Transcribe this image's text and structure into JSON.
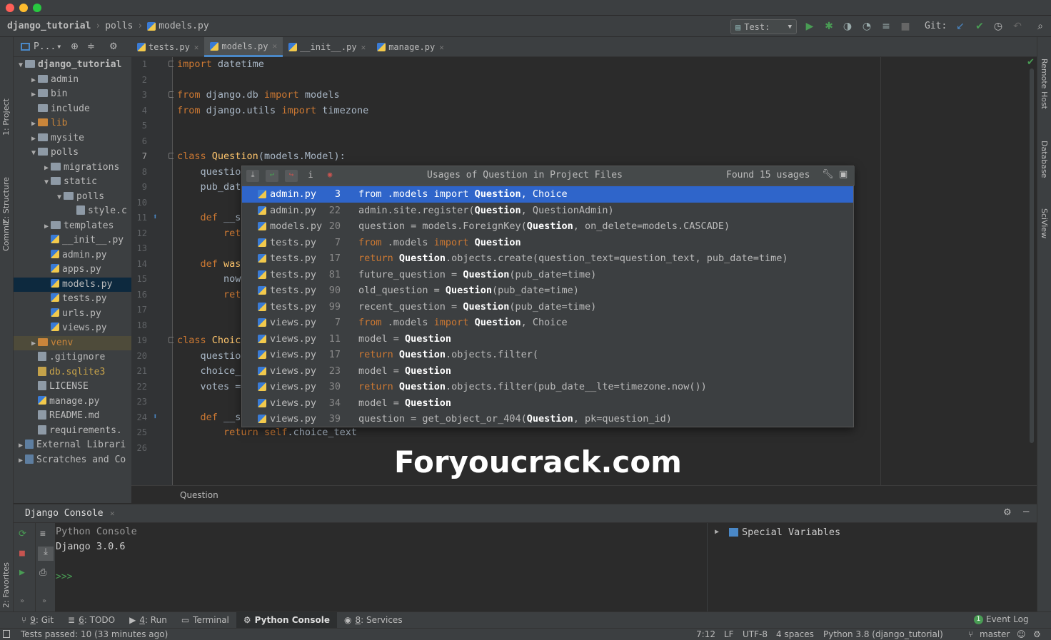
{
  "breadcrumb": {
    "project": "django_tutorial",
    "folder": "polls",
    "file": "models.py"
  },
  "toolbar": {
    "run_config": "Test:",
    "git_label": "Git:"
  },
  "project_panel": {
    "title": "P..."
  },
  "editor_tabs": [
    {
      "label": "tests.py"
    },
    {
      "label": "models.py"
    },
    {
      "label": "__init__.py"
    },
    {
      "label": "manage.py"
    }
  ],
  "left_tools": {
    "project": "1: Project",
    "structure": "Z: Structure",
    "commit": "Commit",
    "favorites": "2: Favorites"
  },
  "right_tools": {
    "remote": "Remote Host",
    "database": "Database",
    "sciview": "SciView"
  },
  "tree": [
    {
      "label": "django_tutorial",
      "type": "folder",
      "depth": 0,
      "arrow": "▼",
      "bold": true
    },
    {
      "label": "admin",
      "type": "folder",
      "depth": 1,
      "arrow": "▶"
    },
    {
      "label": "bin",
      "type": "folder",
      "depth": 1,
      "arrow": "▶"
    },
    {
      "label": "include",
      "type": "folder",
      "depth": 1,
      "arrow": ""
    },
    {
      "label": "lib",
      "type": "folder",
      "depth": 1,
      "arrow": "▶",
      "color": "#c9853a"
    },
    {
      "label": "mysite",
      "type": "folder",
      "depth": 1,
      "arrow": "▶"
    },
    {
      "label": "polls",
      "type": "folder",
      "depth": 1,
      "arrow": "▼"
    },
    {
      "label": "migrations",
      "type": "folder",
      "depth": 2,
      "arrow": "▶"
    },
    {
      "label": "static",
      "type": "folder",
      "depth": 2,
      "arrow": "▼"
    },
    {
      "label": "polls",
      "type": "folder",
      "depth": 3,
      "arrow": "▼"
    },
    {
      "label": "style.c",
      "type": "file",
      "depth": 4,
      "arrow": ""
    },
    {
      "label": "templates",
      "type": "folder",
      "depth": 2,
      "arrow": "▶"
    },
    {
      "label": "__init__.py",
      "type": "py",
      "depth": 2,
      "arrow": ""
    },
    {
      "label": "admin.py",
      "type": "py",
      "depth": 2,
      "arrow": ""
    },
    {
      "label": "apps.py",
      "type": "py",
      "depth": 2,
      "arrow": ""
    },
    {
      "label": "models.py",
      "type": "py",
      "depth": 2,
      "arrow": "",
      "selected": true
    },
    {
      "label": "tests.py",
      "type": "py",
      "depth": 2,
      "arrow": ""
    },
    {
      "label": "urls.py",
      "type": "py",
      "depth": 2,
      "arrow": ""
    },
    {
      "label": "views.py",
      "type": "py",
      "depth": 2,
      "arrow": ""
    },
    {
      "label": "venv",
      "type": "folder",
      "depth": 1,
      "arrow": "▶",
      "color": "#c9853a",
      "venv": true
    },
    {
      "label": ".gitignore",
      "type": "file",
      "depth": 1,
      "arrow": ""
    },
    {
      "label": "db.sqlite3",
      "type": "db",
      "depth": 1,
      "arrow": "",
      "color": "#c9a44a"
    },
    {
      "label": "LICENSE",
      "type": "file",
      "depth": 1,
      "arrow": ""
    },
    {
      "label": "manage.py",
      "type": "py",
      "depth": 1,
      "arrow": ""
    },
    {
      "label": "README.md",
      "type": "file",
      "depth": 1,
      "arrow": ""
    },
    {
      "label": "requirements.",
      "type": "file",
      "depth": 1,
      "arrow": ""
    },
    {
      "label": "External Librari",
      "type": "lib",
      "depth": 0,
      "arrow": "▶"
    },
    {
      "label": "Scratches and Co",
      "type": "lib",
      "depth": 0,
      "arrow": "▶"
    }
  ],
  "line_numbers": [
    "1",
    "2",
    "3",
    "4",
    "5",
    "6",
    "7",
    "8",
    "9",
    "10",
    "11",
    "12",
    "13",
    "14",
    "15",
    "16",
    "17",
    "18",
    "19",
    "20",
    "21",
    "22",
    "23",
    "24",
    "25",
    "26"
  ],
  "code": [
    [
      {
        "t": "import",
        "c": "kw"
      },
      {
        "t": " datetime"
      }
    ],
    [],
    [
      {
        "t": "from",
        "c": "kw"
      },
      {
        "t": " django.db "
      },
      {
        "t": "import",
        "c": "kw"
      },
      {
        "t": " models"
      }
    ],
    [
      {
        "t": "from",
        "c": "kw"
      },
      {
        "t": " django.utils "
      },
      {
        "t": "import",
        "c": "kw"
      },
      {
        "t": " timezone"
      }
    ],
    [],
    [],
    [
      {
        "t": "class",
        "c": "kw"
      },
      {
        "t": " "
      },
      {
        "t": "Question",
        "c": "cls"
      },
      {
        "t": "(models.Model):"
      }
    ],
    [
      {
        "t": "    questio"
      }
    ],
    [
      {
        "t": "    pub_dat"
      }
    ],
    [],
    [
      {
        "t": "    "
      },
      {
        "t": "def",
        "c": "kw"
      },
      {
        "t": " __s"
      }
    ],
    [
      {
        "t": "        "
      },
      {
        "t": "ret",
        "c": "kw"
      }
    ],
    [],
    [
      {
        "t": "    "
      },
      {
        "t": "def",
        "c": "kw"
      },
      {
        "t": " "
      },
      {
        "t": "was",
        "c": "cls"
      }
    ],
    [
      {
        "t": "        now"
      }
    ],
    [
      {
        "t": "        "
      },
      {
        "t": "ret",
        "c": "kw"
      }
    ],
    [],
    [],
    [
      {
        "t": "class",
        "c": "kw"
      },
      {
        "t": " "
      },
      {
        "t": "Choic",
        "c": "cls"
      }
    ],
    [
      {
        "t": "    questio"
      }
    ],
    [
      {
        "t": "    choice_"
      }
    ],
    [
      {
        "t": "    votes ="
      }
    ],
    [],
    [
      {
        "t": "    "
      },
      {
        "t": "def",
        "c": "kw"
      },
      {
        "t": " __s"
      }
    ],
    [
      {
        "t": "        "
      },
      {
        "t": "return",
        "c": "kw"
      },
      {
        "t": " "
      },
      {
        "t": "self",
        "c": "kw"
      },
      {
        "t": ".choice_text"
      }
    ],
    []
  ],
  "editor_breadcrumb": "Question",
  "usages_popup": {
    "title": "Usages of Question in Project Files",
    "found": "Found 15 usages",
    "rows": [
      {
        "file": "admin.py",
        "line": "3",
        "code": [
          {
            "t": "from",
            "k": 1
          },
          {
            "t": " .models "
          },
          {
            "t": "import",
            "k": 1
          },
          {
            "t": " "
          },
          {
            "t": "Question",
            "b": 1
          },
          {
            "t": ", Choice"
          }
        ]
      },
      {
        "file": "admin.py",
        "line": "22",
        "code": [
          {
            "t": "admin.site.register("
          },
          {
            "t": "Question",
            "b": 1
          },
          {
            "t": ", QuestionAdmin)"
          }
        ]
      },
      {
        "file": "models.py",
        "line": "20",
        "code": [
          {
            "t": "question = models.ForeignKey("
          },
          {
            "t": "Question",
            "b": 1
          },
          {
            "t": ", on_delete=models.CASCADE)"
          }
        ]
      },
      {
        "file": "tests.py",
        "line": "7",
        "code": [
          {
            "t": "from",
            "k": 1
          },
          {
            "t": " .models "
          },
          {
            "t": "import",
            "k": 1
          },
          {
            "t": " "
          },
          {
            "t": "Question",
            "b": 1
          }
        ]
      },
      {
        "file": "tests.py",
        "line": "17",
        "code": [
          {
            "t": "return",
            "k": 1
          },
          {
            "t": " "
          },
          {
            "t": "Question",
            "b": 1
          },
          {
            "t": ".objects.create(question_text=question_text, pub_date=time)"
          }
        ]
      },
      {
        "file": "tests.py",
        "line": "81",
        "code": [
          {
            "t": "future_question = "
          },
          {
            "t": "Question",
            "b": 1
          },
          {
            "t": "(pub_date=time)"
          }
        ]
      },
      {
        "file": "tests.py",
        "line": "90",
        "code": [
          {
            "t": "old_question = "
          },
          {
            "t": "Question",
            "b": 1
          },
          {
            "t": "(pub_date=time)"
          }
        ]
      },
      {
        "file": "tests.py",
        "line": "99",
        "code": [
          {
            "t": "recent_question = "
          },
          {
            "t": "Question",
            "b": 1
          },
          {
            "t": "(pub_date=time)"
          }
        ]
      },
      {
        "file": "views.py",
        "line": "7",
        "code": [
          {
            "t": "from",
            "k": 1
          },
          {
            "t": " .models "
          },
          {
            "t": "import",
            "k": 1
          },
          {
            "t": " "
          },
          {
            "t": "Question",
            "b": 1
          },
          {
            "t": ", Choice"
          }
        ]
      },
      {
        "file": "views.py",
        "line": "11",
        "code": [
          {
            "t": "model = "
          },
          {
            "t": "Question",
            "b": 1
          }
        ]
      },
      {
        "file": "views.py",
        "line": "17",
        "code": [
          {
            "t": "return",
            "k": 1
          },
          {
            "t": " "
          },
          {
            "t": "Question",
            "b": 1
          },
          {
            "t": ".objects.filter("
          }
        ]
      },
      {
        "file": "views.py",
        "line": "23",
        "code": [
          {
            "t": "model = "
          },
          {
            "t": "Question",
            "b": 1
          }
        ]
      },
      {
        "file": "views.py",
        "line": "30",
        "code": [
          {
            "t": "return",
            "k": 1
          },
          {
            "t": " "
          },
          {
            "t": "Question",
            "b": 1
          },
          {
            "t": ".objects.filter(pub_date__lte=timezone.now())"
          }
        ]
      },
      {
        "file": "views.py",
        "line": "34",
        "code": [
          {
            "t": "model = "
          },
          {
            "t": "Question",
            "b": 1
          }
        ]
      },
      {
        "file": "views.py",
        "line": "39",
        "code": [
          {
            "t": "question = get_object_or_404("
          },
          {
            "t": "Question",
            "b": 1
          },
          {
            "t": ", pk=question_id)"
          }
        ]
      }
    ]
  },
  "watermark": "Foryoucrack.com",
  "console": {
    "tab": "Django Console",
    "line1": "Python Console",
    "line2": "Django 3.0.6",
    "prompt": ">>>",
    "vars": "Special Variables"
  },
  "bottom_tabs": [
    {
      "num": "9",
      "label": ": Git"
    },
    {
      "num": "6",
      "label": ": TODO"
    },
    {
      "num": "4",
      "label": ": Run"
    },
    {
      "num": "",
      "label": "Terminal"
    },
    {
      "num": "",
      "label": "Python Console"
    },
    {
      "num": "8",
      "label": ": Services"
    }
  ],
  "event_log": {
    "count": "1",
    "label": "Event Log"
  },
  "status": {
    "left": "Tests passed: 10 (33 minutes ago)",
    "pos": "7:12",
    "le": "LF",
    "enc": "UTF-8",
    "indent": "4 spaces",
    "interp": "Python 3.8 (django_tutorial)",
    "branch": "master"
  },
  "colors": {
    "accent": "#2f65ca",
    "keyword": "#cc7832",
    "classname": "#ffc66d",
    "run_green": "#499c54"
  }
}
